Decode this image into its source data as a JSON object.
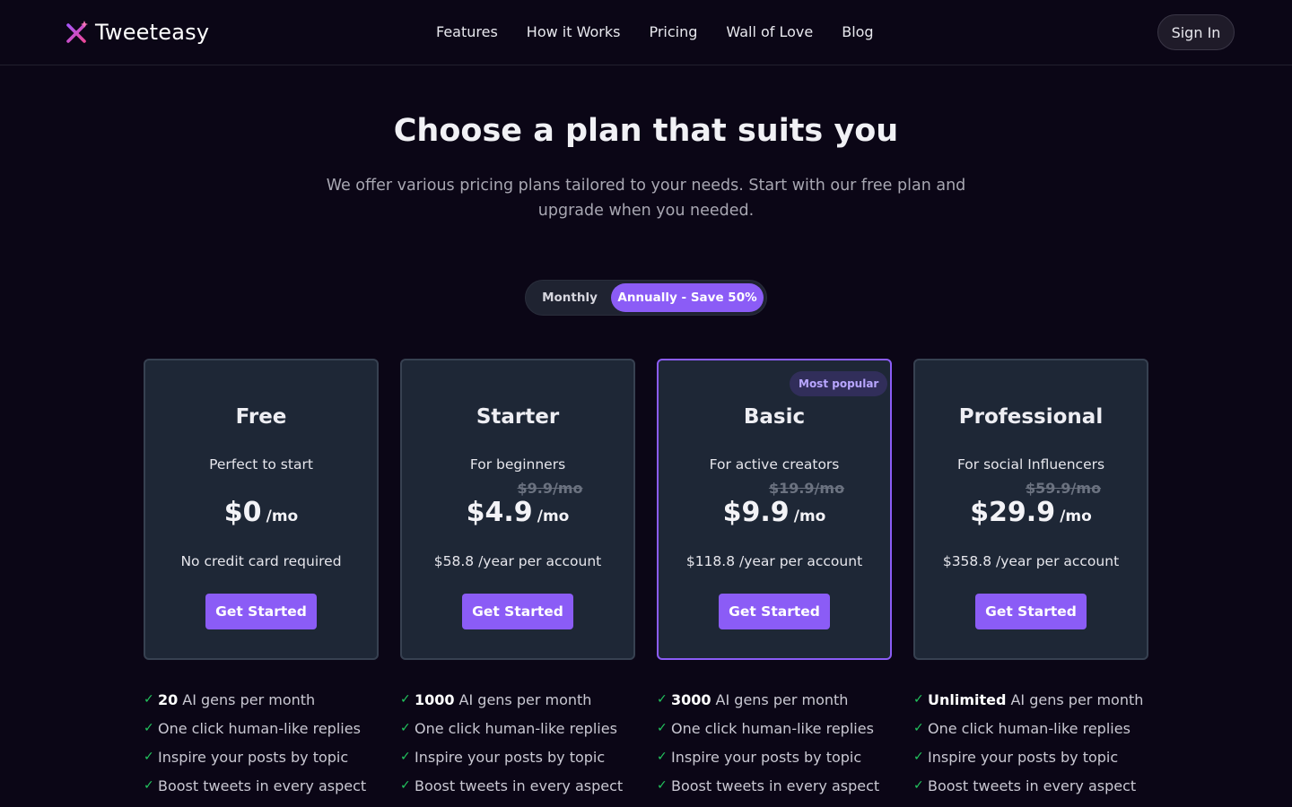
{
  "brand": {
    "name": "Tweeteasy",
    "logo_icon": "sparkle-x-logo-icon"
  },
  "nav": {
    "items": [
      "Features",
      "How it Works",
      "Pricing",
      "Wall of Love",
      "Blog"
    ]
  },
  "signin_label": "Sign In",
  "hero": {
    "title": "Choose a plan that suits you",
    "subtitle": "We offer various pricing plans tailored to your needs. Start with our free plan and upgrade when you needed."
  },
  "billing_toggle": {
    "monthly": "Monthly",
    "annually": "Annually - Save 50%",
    "selected": "annually"
  },
  "plans": [
    {
      "name": "Free",
      "desc": "Perfect to start",
      "old_price": "",
      "price": "$0",
      "per": "/mo",
      "note": "No credit card required",
      "button": "Get Started",
      "badge": ""
    },
    {
      "name": "Starter",
      "desc": "For beginners",
      "old_price": "$9.9/mo",
      "price": "$4.9",
      "per": "/mo",
      "note": "$58.8 /year per account",
      "button": "Get Started",
      "badge": ""
    },
    {
      "name": "Basic",
      "desc": "For active creators",
      "old_price": "$19.9/mo",
      "price": "$9.9",
      "per": "/mo",
      "note": "$118.8 /year per account",
      "button": "Get Started",
      "badge": "Most popular"
    },
    {
      "name": "Professional",
      "desc": "For social Influencers",
      "old_price": "$59.9/mo",
      "price": "$29.9",
      "per": "/mo",
      "note": "$358.8 /year per account",
      "button": "Get Started",
      "badge": ""
    }
  ],
  "features": [
    {
      "quota": "20",
      "items": [
        "AI gens per month",
        "One click human-like replies",
        "Inspire your posts by topic",
        "Boost tweets in every aspect"
      ]
    },
    {
      "quota": "1000",
      "items": [
        "AI gens per month",
        "One click human-like replies",
        "Inspire your posts by topic",
        "Boost tweets in every aspect"
      ]
    },
    {
      "quota": "3000",
      "items": [
        "AI gens per month",
        "One click human-like replies",
        "Inspire your posts by topic",
        "Boost tweets in every aspect"
      ]
    },
    {
      "quota": "Unlimited",
      "items": [
        "AI gens per month",
        "One click human-like replies",
        "Inspire your posts by topic",
        "Boost tweets in every aspect"
      ]
    }
  ],
  "colors": {
    "accent": "#8b5cf6",
    "background": "#0b0616",
    "card": "#1e2736",
    "check": "#22c55e"
  }
}
